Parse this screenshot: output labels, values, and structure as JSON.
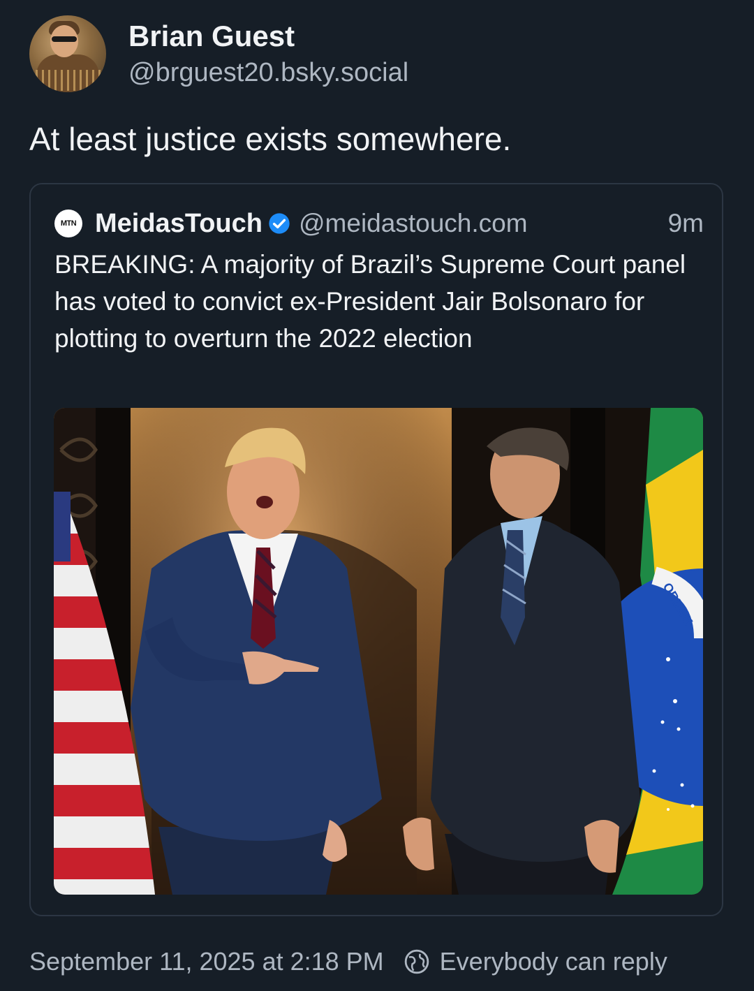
{
  "author": {
    "display_name": "Brian Guest",
    "handle": "@brguest20.bsky.social"
  },
  "post": {
    "text": "At least justice exists somewhere."
  },
  "quote": {
    "logo_text": "MTN",
    "name": "MeidasTouch",
    "handle": "@meidastouch.com",
    "time": "9m",
    "text": "BREAKING: A majority of Brazil’s Supreme Court panel has voted to convict ex-President Jair Bolsonaro for plotting to overturn the 2022 election",
    "verified_color": "#1d8cf8"
  },
  "footer": {
    "timestamp": "September 11, 2025 at 2:18 PM",
    "reply_setting": "Everybody can reply"
  },
  "photo_flag_text": "ORDEM"
}
